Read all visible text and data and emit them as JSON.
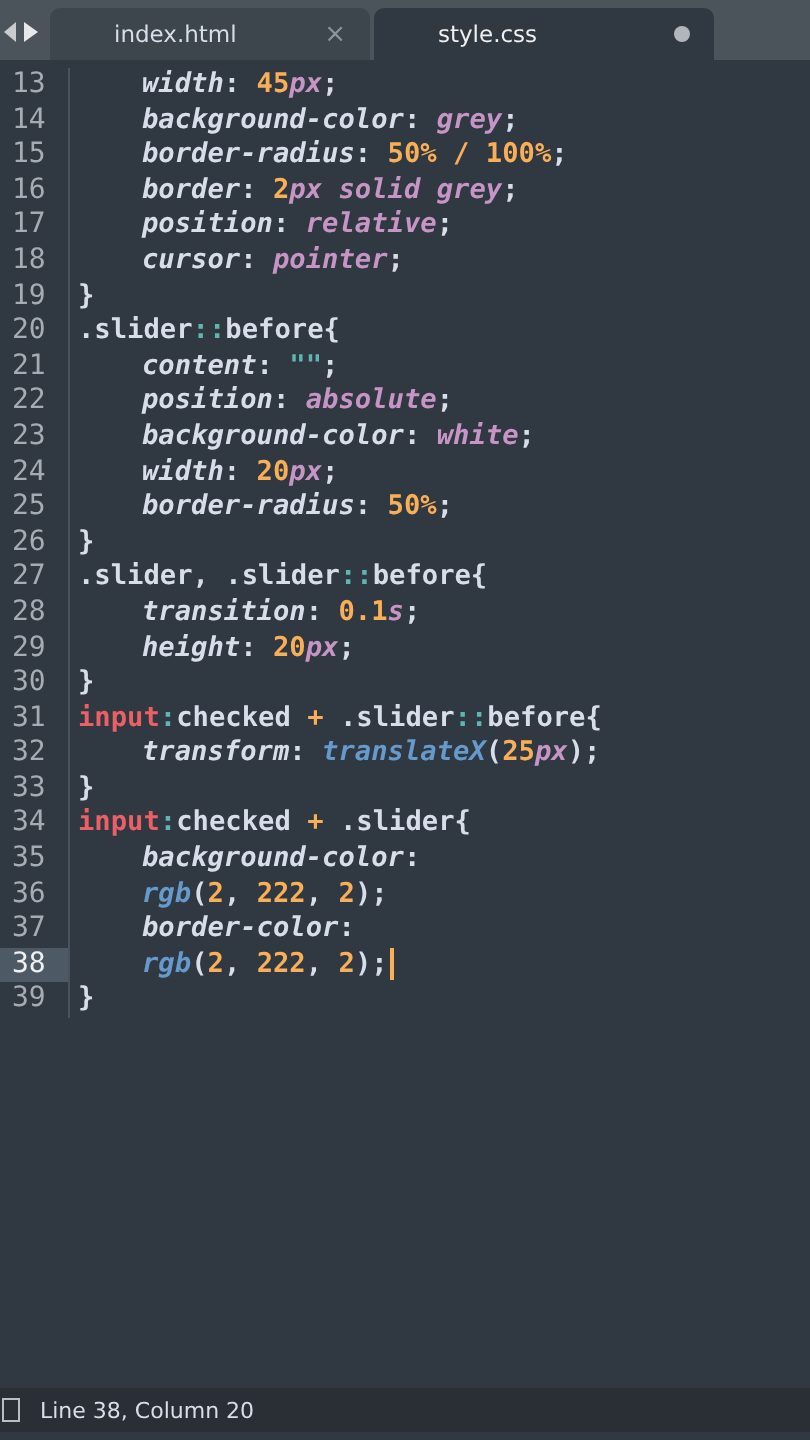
{
  "tabs": [
    {
      "label": "index.html",
      "selected": false,
      "dirty": false,
      "close": "×"
    },
    {
      "label": "style.css",
      "selected": true,
      "dirty": true
    }
  ],
  "lines": [
    {
      "number": "13",
      "indented": true,
      "current": false,
      "tokens": [
        {
          "kind": "property",
          "text": "width"
        },
        {
          "kind": "punct",
          "text": ": "
        },
        {
          "kind": "number",
          "text": "45"
        },
        {
          "kind": "keyword",
          "text": "px"
        },
        {
          "kind": "punct",
          "text": ";"
        }
      ]
    },
    {
      "number": "14",
      "indented": true,
      "current": false,
      "tokens": [
        {
          "kind": "property",
          "text": "background-color"
        },
        {
          "kind": "punct",
          "text": ": "
        },
        {
          "kind": "keyword",
          "text": "grey"
        },
        {
          "kind": "punct",
          "text": ";"
        }
      ]
    },
    {
      "number": "15",
      "indented": true,
      "current": false,
      "tokens": [
        {
          "kind": "property",
          "text": "border-radius"
        },
        {
          "kind": "punct",
          "text": ": "
        },
        {
          "kind": "number",
          "text": "50% / 100%"
        },
        {
          "kind": "punct",
          "text": ";"
        }
      ]
    },
    {
      "number": "16",
      "indented": true,
      "current": false,
      "tokens": [
        {
          "kind": "property",
          "text": "border"
        },
        {
          "kind": "punct",
          "text": ": "
        },
        {
          "kind": "number",
          "text": "2"
        },
        {
          "kind": "keyword",
          "text": "px solid grey"
        },
        {
          "kind": "punct",
          "text": ";"
        }
      ]
    },
    {
      "number": "17",
      "indented": true,
      "current": false,
      "tokens": [
        {
          "kind": "property",
          "text": "position"
        },
        {
          "kind": "punct",
          "text": ": "
        },
        {
          "kind": "keyword",
          "text": "relative"
        },
        {
          "kind": "punct",
          "text": ";"
        }
      ]
    },
    {
      "number": "18",
      "indented": true,
      "current": false,
      "tokens": [
        {
          "kind": "property",
          "text": "cursor"
        },
        {
          "kind": "punct",
          "text": ": "
        },
        {
          "kind": "keyword",
          "text": "pointer"
        },
        {
          "kind": "punct",
          "text": ";"
        }
      ]
    },
    {
      "number": "19",
      "indented": false,
      "current": false,
      "tokens": [
        {
          "kind": "punct",
          "text": "}"
        }
      ]
    },
    {
      "number": "20",
      "indented": false,
      "current": false,
      "tokens": [
        {
          "kind": "selector",
          "text": ".slider"
        },
        {
          "kind": "operator",
          "text": "::"
        },
        {
          "kind": "selector",
          "text": "before{"
        }
      ]
    },
    {
      "number": "21",
      "indented": true,
      "current": false,
      "tokens": [
        {
          "kind": "property",
          "text": "content"
        },
        {
          "kind": "punct",
          "text": ": "
        },
        {
          "kind": "string",
          "text": "\"\""
        },
        {
          "kind": "punct",
          "text": ";"
        }
      ]
    },
    {
      "number": "22",
      "indented": true,
      "current": false,
      "tokens": [
        {
          "kind": "property",
          "text": "position"
        },
        {
          "kind": "punct",
          "text": ": "
        },
        {
          "kind": "keyword",
          "text": "absolute"
        },
        {
          "kind": "punct",
          "text": ";"
        }
      ]
    },
    {
      "number": "23",
      "indented": true,
      "current": false,
      "tokens": [
        {
          "kind": "property",
          "text": "background-color"
        },
        {
          "kind": "punct",
          "text": ": "
        },
        {
          "kind": "keyword",
          "text": "white"
        },
        {
          "kind": "punct",
          "text": ";"
        }
      ]
    },
    {
      "number": "24",
      "indented": true,
      "current": false,
      "tokens": [
        {
          "kind": "property",
          "text": "width"
        },
        {
          "kind": "punct",
          "text": ": "
        },
        {
          "kind": "number",
          "text": "20"
        },
        {
          "kind": "keyword",
          "text": "px"
        },
        {
          "kind": "punct",
          "text": ";"
        }
      ]
    },
    {
      "number": "25",
      "indented": true,
      "current": false,
      "tokens": [
        {
          "kind": "property",
          "text": "border-radius"
        },
        {
          "kind": "punct",
          "text": ": "
        },
        {
          "kind": "number",
          "text": "50%"
        },
        {
          "kind": "punct",
          "text": ";"
        }
      ]
    },
    {
      "number": "26",
      "indented": false,
      "current": false,
      "tokens": [
        {
          "kind": "punct",
          "text": "}"
        }
      ]
    },
    {
      "number": "27",
      "indented": false,
      "current": false,
      "tokens": [
        {
          "kind": "selector",
          "text": ".slider, .slider"
        },
        {
          "kind": "operator",
          "text": "::"
        },
        {
          "kind": "selector",
          "text": "before{"
        }
      ]
    },
    {
      "number": "28",
      "indented": true,
      "current": false,
      "tokens": [
        {
          "kind": "property",
          "text": "transition"
        },
        {
          "kind": "punct",
          "text": ": "
        },
        {
          "kind": "number",
          "text": "0.1"
        },
        {
          "kind": "keyword",
          "text": "s"
        },
        {
          "kind": "punct",
          "text": ";"
        }
      ]
    },
    {
      "number": "29",
      "indented": true,
      "current": false,
      "tokens": [
        {
          "kind": "property",
          "text": "height"
        },
        {
          "kind": "punct",
          "text": ": "
        },
        {
          "kind": "number",
          "text": "20"
        },
        {
          "kind": "keyword",
          "text": "px"
        },
        {
          "kind": "punct",
          "text": ";"
        }
      ]
    },
    {
      "number": "30",
      "indented": false,
      "current": false,
      "tokens": [
        {
          "kind": "punct",
          "text": "}"
        }
      ]
    },
    {
      "number": "31",
      "indented": false,
      "current": false,
      "tokens": [
        {
          "kind": "tag",
          "text": "input"
        },
        {
          "kind": "operator",
          "text": ":"
        },
        {
          "kind": "selector",
          "text": "checked "
        },
        {
          "kind": "number",
          "text": "+"
        },
        {
          "kind": "selector",
          "text": " .slider"
        },
        {
          "kind": "operator",
          "text": "::"
        },
        {
          "kind": "selector",
          "text": "before{"
        }
      ]
    },
    {
      "number": "32",
      "indented": true,
      "current": false,
      "tokens": [
        {
          "kind": "property",
          "text": "transform"
        },
        {
          "kind": "punct",
          "text": ": "
        },
        {
          "kind": "function",
          "text": "translateX"
        },
        {
          "kind": "punct",
          "text": "("
        },
        {
          "kind": "number",
          "text": "25"
        },
        {
          "kind": "keyword",
          "text": "px"
        },
        {
          "kind": "punct",
          "text": ");"
        }
      ]
    },
    {
      "number": "33",
      "indented": false,
      "current": false,
      "tokens": [
        {
          "kind": "punct",
          "text": "}"
        }
      ]
    },
    {
      "number": "34",
      "indented": false,
      "current": false,
      "tokens": [
        {
          "kind": "tag",
          "text": "input"
        },
        {
          "kind": "operator",
          "text": ":"
        },
        {
          "kind": "selector",
          "text": "checked "
        },
        {
          "kind": "number",
          "text": "+"
        },
        {
          "kind": "selector",
          "text": " .slider{"
        }
      ]
    },
    {
      "number": "35",
      "indented": true,
      "current": false,
      "tokens": [
        {
          "kind": "property",
          "text": "background-color"
        },
        {
          "kind": "punct",
          "text": ":"
        }
      ]
    },
    {
      "number": "36",
      "indented": true,
      "current": false,
      "tokens": [
        {
          "kind": "function",
          "text": "rgb"
        },
        {
          "kind": "punct",
          "text": "("
        },
        {
          "kind": "number",
          "text": "2"
        },
        {
          "kind": "punct",
          "text": ", "
        },
        {
          "kind": "number",
          "text": "222"
        },
        {
          "kind": "punct",
          "text": ", "
        },
        {
          "kind": "number",
          "text": "2"
        },
        {
          "kind": "punct",
          "text": ");"
        }
      ]
    },
    {
      "number": "37",
      "indented": true,
      "current": false,
      "tokens": [
        {
          "kind": "property",
          "text": "border-color"
        },
        {
          "kind": "punct",
          "text": ":"
        }
      ]
    },
    {
      "number": "38",
      "indented": true,
      "current": true,
      "tokens": [
        {
          "kind": "function",
          "text": "rgb"
        },
        {
          "kind": "punct",
          "text": "("
        },
        {
          "kind": "number",
          "text": "2"
        },
        {
          "kind": "punct",
          "text": ", "
        },
        {
          "kind": "number",
          "text": "222"
        },
        {
          "kind": "punct",
          "text": ", "
        },
        {
          "kind": "number",
          "text": "2"
        },
        {
          "kind": "punct",
          "text": ");"
        }
      ]
    },
    {
      "number": "39",
      "indented": false,
      "current": false,
      "tokens": [
        {
          "kind": "punct",
          "text": "}"
        }
      ]
    }
  ],
  "status_bar": {
    "position": "Line 38, Column 20"
  }
}
